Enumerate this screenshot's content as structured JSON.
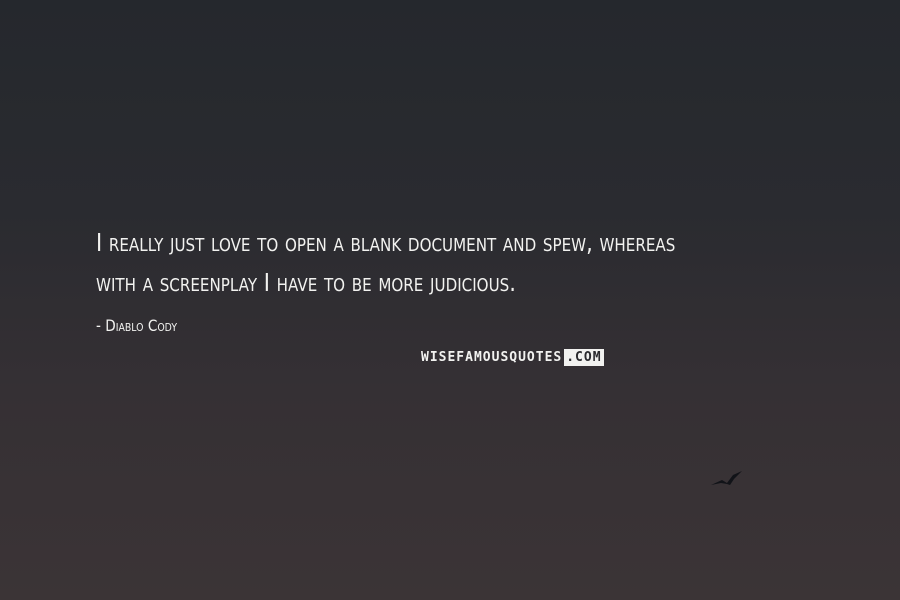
{
  "quote": {
    "line1": "I really just love to open a blank document and spew, whereas",
    "line2": "with a screenplay I have to be more judicious."
  },
  "author": "- Diablo Cody",
  "watermark": {
    "left": "WISEFAMOUSQUOTES",
    "right": ".COM"
  },
  "colors": {
    "text": "#f2f2f0",
    "background_top": "#25282d",
    "background_bottom": "#3b3436"
  },
  "icons": {
    "bird": "bird-silhouette-icon"
  }
}
